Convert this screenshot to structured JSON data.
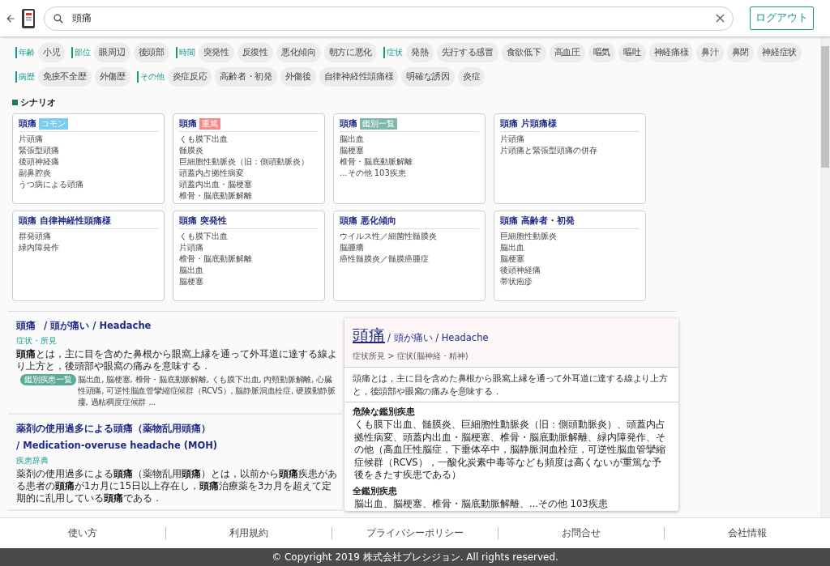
{
  "search": {
    "value": "頭痛"
  },
  "logout": "ログアウト",
  "filter_groups": [
    {
      "label": "年齢",
      "chips": [
        "小児"
      ]
    },
    {
      "label": "部位",
      "chips": [
        "眼周辺",
        "後頭部"
      ]
    },
    {
      "label": "時間",
      "chips": [
        "突発性",
        "反復性",
        "悪化傾向",
        "朝方に悪化"
      ]
    },
    {
      "label": "症状",
      "chips": [
        "発熱",
        "先行する感冒",
        "食欲低下",
        "高血圧",
        "嘔気",
        "嘔吐",
        "神経痛様",
        "鼻汁",
        "鼻閉",
        "神経症状"
      ]
    },
    {
      "label": "病歴",
      "chips": [
        "免疫不全歴",
        "外傷歴"
      ]
    },
    {
      "label": "その他",
      "chips": [
        "炎症反応",
        "高齢者・初発",
        "外傷後",
        "自律神経性頭痛様",
        "明確な誘因",
        "炎症"
      ]
    }
  ],
  "scenario_heading": "シナリオ",
  "scenarios": [
    {
      "title": "頭痛",
      "tag": {
        "text": "コモン",
        "color": "#7ccbf0"
      },
      "items": [
        "片頭痛",
        "緊張型頭痛",
        "後頭神経痛",
        "副鼻腔炎",
        "うつ病による頭痛"
      ]
    },
    {
      "title": "頭痛",
      "tag": {
        "text": "重篤",
        "color": "#f28b8b"
      },
      "items": [
        "くも膜下出血",
        "髄膜炎",
        "巨細胞性動脈炎（旧：側頭動脈炎）",
        "頭蓋内占拠性病変",
        "頭蓋内出血・脳梗塞",
        "椎骨・脳底動脈解離"
      ]
    },
    {
      "title": "頭痛",
      "tag": {
        "text": "鑑別一覧",
        "color": "#7fb8a9"
      },
      "items": [
        "脳出血",
        "脳梗塞",
        "椎骨・脳底動脈解離",
        "...その他 103疾患"
      ]
    },
    {
      "title": "頭痛 片頭痛様",
      "items": [
        "片頭痛",
        "片頭痛と緊張型頭痛の併存"
      ]
    },
    {
      "title": "頭痛 自律神経性頭痛様",
      "items": [
        "群発頭痛",
        "緑内障発作"
      ]
    },
    {
      "title": "頭痛 突発性",
      "items": [
        "くも膜下出血",
        "片頭痛",
        "椎骨・脳底動脈解離",
        "脳出血",
        "脳梗塞"
      ]
    },
    {
      "title": "頭痛 悪化傾向",
      "items": [
        "ウイルス性／細菌性髄膜炎",
        "脳腫瘍",
        "癌性髄膜炎／髄膜癌腫症"
      ]
    },
    {
      "title": "頭痛 高齢者・初発",
      "items": [
        "巨細胞性動脈炎",
        "脳出血",
        "脳梗塞",
        "後頭神経痛",
        "帯状疱疹"
      ]
    }
  ],
  "results": [
    {
      "title": "頭痛",
      "alt": "/ 頭が痛い / Headache",
      "category": "症状・所見",
      "description": "**頭痛**とは，主に目を含めた鼻根から眼窩上縁を通って外耳道に達する線より上方と，後頭部や眼窩の痛みを意味する．",
      "differential": {
        "badge": "鑑別疾患一覧",
        "text": "脳出血, 脳梗塞, 椎骨・脳底動脈解離, くも膜下出血, 内頸動脈解離, 心臓性頭痛, 可逆性脳血管攣縮症候群（RCVS）, 脳静脈洞血栓症, 硬膜動静脈瘻, 過粘稠度症候群 ..."
      }
    },
    {
      "title": "薬剤の使用過多による頭痛（薬物乱用頭痛）",
      "alt": "/ Medication-overuse headache (MOH)",
      "category": "疾患辞典",
      "description": "薬剤の使用過多による**頭痛**（薬物乱用**頭痛**）とは，以前から**頭痛**疾患がある患者の**頭痛**が1カ月に15日以上存在し，**頭痛**治療薬を3カ月を超えて定期的に乱用している**頭痛**である．"
    }
  ],
  "detail": {
    "title": "頭痛",
    "alt": "/ 頭が痛い / Headache",
    "breadcrumb": "症状所見 > 症状(脳神経・精神)",
    "summary": "頭痛とは，主に目を含めた鼻根から眼窩上縁を通って外耳道に達する線より上方と，後頭部や眼窩の痛みを意味する．",
    "sections": [
      {
        "heading": "危険な鑑別疾患",
        "text": "くも膜下出血、髄膜炎、巨細胞性動脈炎（旧：側頭動脈炎）、頭蓋内占拠性病変、頭蓋内出血・脳梗塞、椎骨・脳底動脈解離、緑内障発作、その他（高血圧性脳症，下垂体卒中，脳静脈洞血栓症，可逆性脳血管攣縮症候群（RCVS），一酸化炭素中毒等なども頻度は高くないが重篤な予後をきたす疾患である）"
      },
      {
        "heading": "全鑑別疾患",
        "text": "脳出血、脳梗塞、椎骨・脳底動脈解離、...その他 103疾患"
      }
    ]
  },
  "footer_links": [
    "使い方",
    "利用規約",
    "プライバシーポリシー",
    "お問合せ",
    "会社情報"
  ],
  "copyright": "© Copyright 2019 株式会社プレシジョン. All rights reserved."
}
